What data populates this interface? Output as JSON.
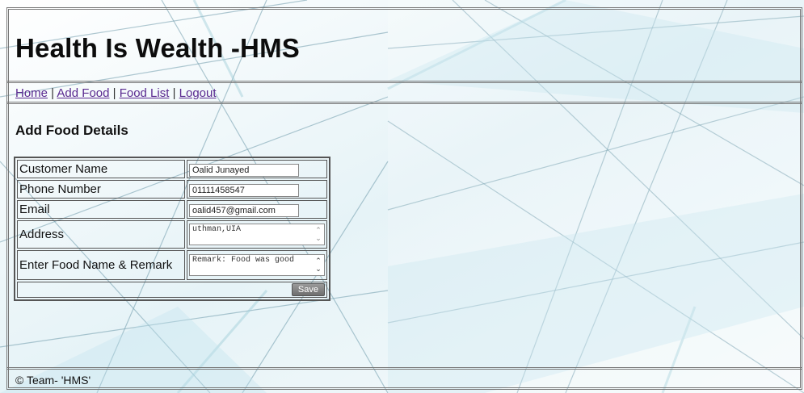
{
  "header": {
    "title": "Health Is Wealth -HMS"
  },
  "nav": {
    "items": [
      {
        "label": "Home"
      },
      {
        "label": "Add Food"
      },
      {
        "label": "Food List"
      },
      {
        "label": "Logout"
      }
    ],
    "separator": " | "
  },
  "main": {
    "section_title": "Add Food Details",
    "form": {
      "customer_name": {
        "label": "Customer Name",
        "value": "Oalid Junayed"
      },
      "phone": {
        "label": "Phone Number",
        "value": "01111458547"
      },
      "email": {
        "label": "Email",
        "value": "oalid457@gmail.com"
      },
      "address": {
        "label": "Address",
        "value": "uthman,UIA"
      },
      "food": {
        "label": "Enter Food Name & Remark",
        "value": "Remark: Food was good"
      },
      "save_label": "Save"
    }
  },
  "footer": {
    "text": "© Team- 'HMS'"
  },
  "colors": {
    "link": "#5a2a90",
    "border": "#777777",
    "save_button": "#7a7a7a"
  }
}
